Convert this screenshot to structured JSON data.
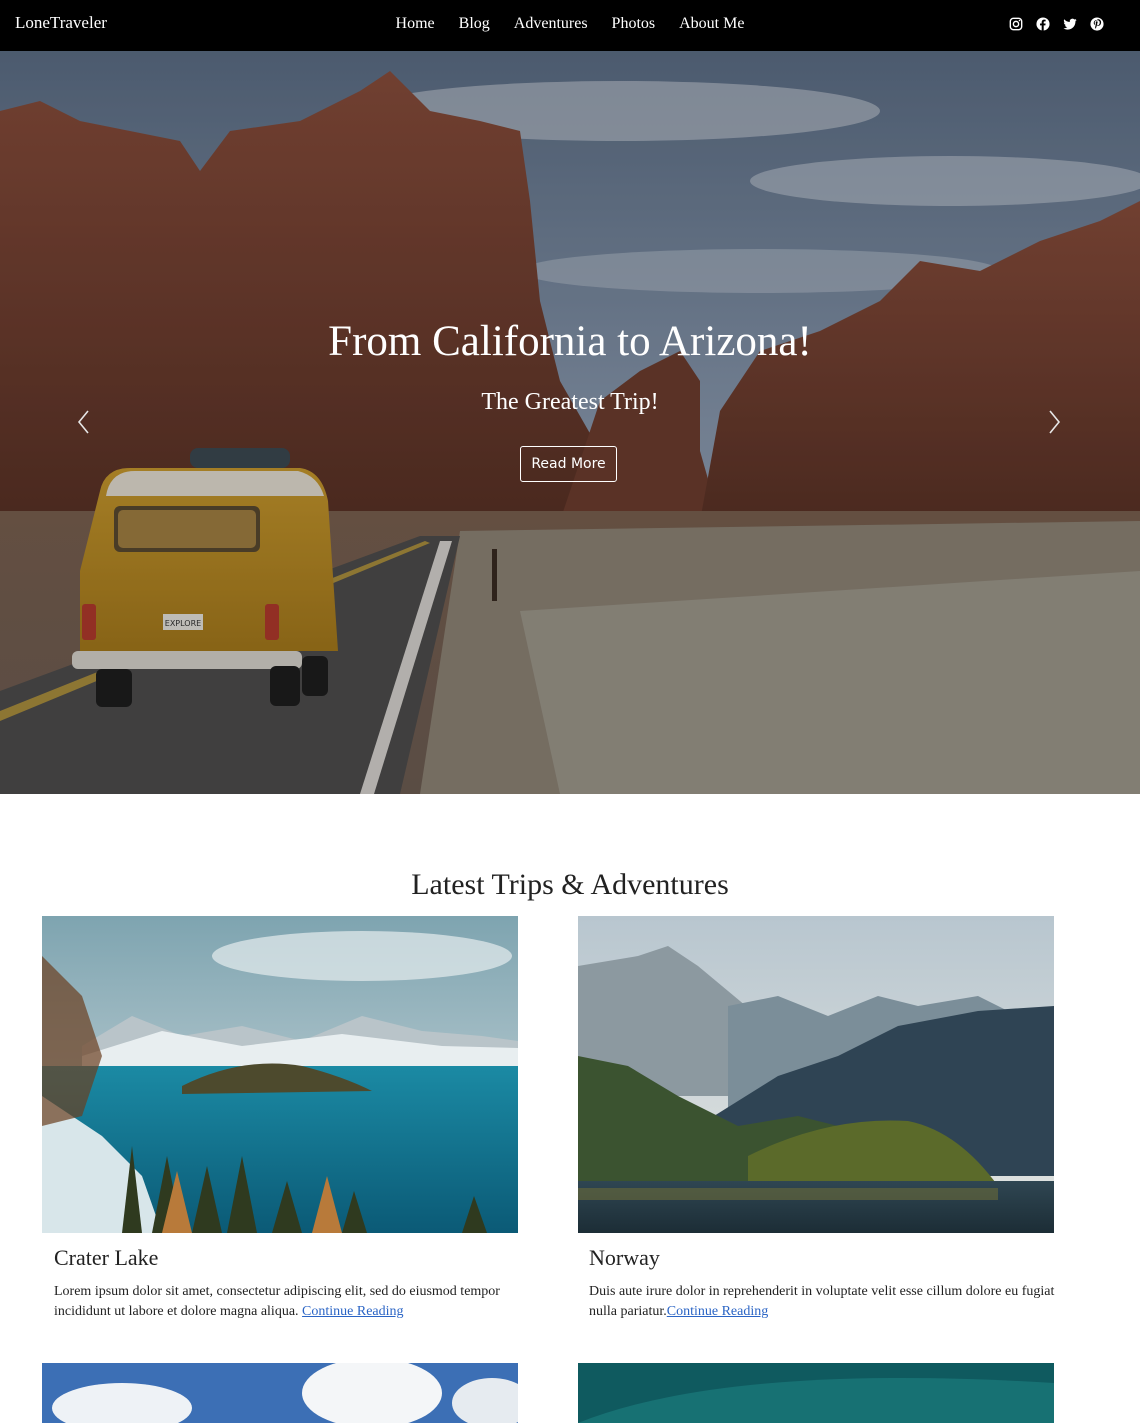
{
  "brand": "LoneTraveler",
  "nav": {
    "items": [
      "Home",
      "Blog",
      "Adventures",
      "Photos",
      "About Me"
    ]
  },
  "social_icons": [
    "instagram-icon",
    "facebook-icon",
    "twitter-icon",
    "pinterest-icon"
  ],
  "hero": {
    "title": "From California to Arizona!",
    "subtitle": "The Greatest Trip!",
    "button_label": "Read More",
    "plate_text": "EXPLORE"
  },
  "section": {
    "title": "Latest Trips & Adventures"
  },
  "posts": [
    {
      "title": "Crater Lake",
      "excerpt": "Lorem ipsum dolor sit amet, consectetur adipiscing elit, sed do eiusmod tempor incididunt ut labore et dolore magna aliqua. ",
      "link": "Continue Reading"
    },
    {
      "title": "Norway",
      "excerpt": "Duis aute irure dolor in reprehenderit in voluptate velit esse cillum dolore eu fugiat nulla pariatur.",
      "link": "Continue Reading"
    }
  ],
  "colors": {
    "navbar": "#000000",
    "link": "#2a64c5",
    "text": "#222222"
  }
}
